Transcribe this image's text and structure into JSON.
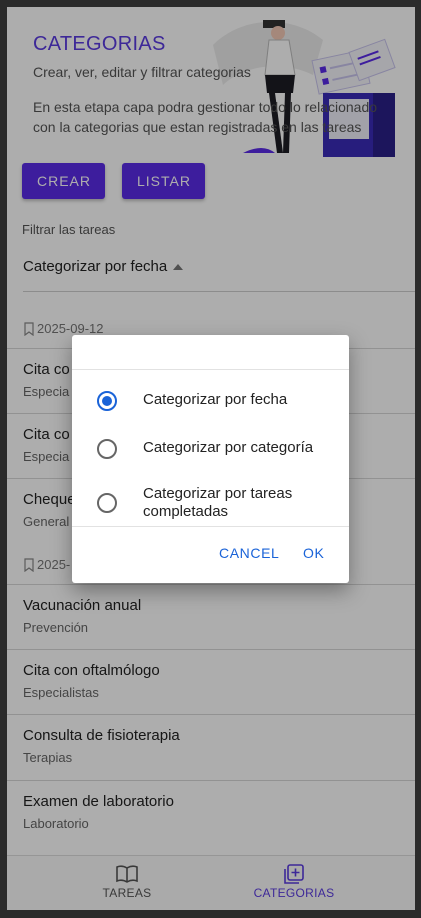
{
  "header": {
    "title": "CATEGORIAS",
    "subtitle": "Crear, ver, editar y filtrar categorias",
    "description": "En esta etapa capa podra gestionar todo lo relacionado con la categorias que estan registradas en las tareas"
  },
  "actions": {
    "create_label": "CREAR",
    "list_label": "LISTAR"
  },
  "filter": {
    "label": "Filtrar las tareas",
    "selected": "Categorizar por fecha"
  },
  "groups": [
    {
      "date": "2025-09-12",
      "items": [
        {
          "title": "Cita co",
          "subtitle": "Especia"
        },
        {
          "title": "Cita co",
          "subtitle": "Especia"
        },
        {
          "title": "Cheque",
          "subtitle": "General"
        }
      ]
    },
    {
      "date": "2025-",
      "items": [
        {
          "title": "Vacunación anual",
          "subtitle": "Prevención"
        },
        {
          "title": "Cita con oftalmólogo",
          "subtitle": "Especialistas"
        },
        {
          "title": "Consulta de fisioterapia",
          "subtitle": "Terapias"
        },
        {
          "title": "Examen de laboratorio",
          "subtitle": "Laboratorio"
        }
      ]
    }
  ],
  "dialog": {
    "options": [
      {
        "label": "Categorizar por fecha",
        "selected": true
      },
      {
        "label": "Categorizar por categoría",
        "selected": false
      },
      {
        "label": "Categorizar por tareas completadas",
        "selected": false
      }
    ],
    "cancel_label": "CANCEL",
    "ok_label": "OK"
  },
  "bottom_nav": {
    "tareas": {
      "label": "TAREAS",
      "icon": "book-icon"
    },
    "categorias": {
      "label": "CATEGORIAS",
      "icon": "add-box-icon",
      "active": true
    }
  },
  "colors": {
    "accent": "#5b2be8",
    "dialog_accent": "#1a63d8"
  }
}
